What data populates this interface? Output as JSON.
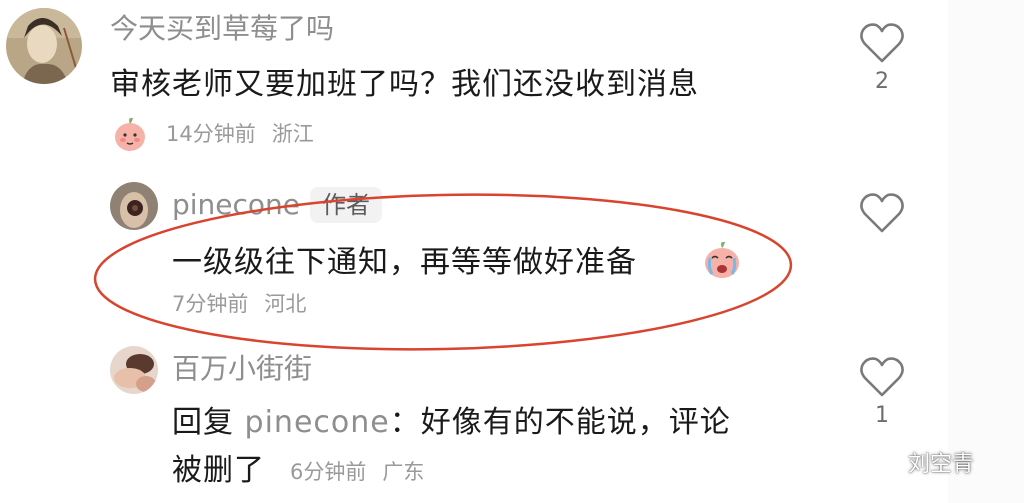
{
  "comments": [
    {
      "username": "今天买到草莓了吗",
      "text": "审核老师又要加班了吗？我们还没收到消息",
      "time": "14分钟前",
      "location": "浙江",
      "likes": "2",
      "emoji": "peach-face-icon"
    }
  ],
  "replies": [
    {
      "username": "pinecone",
      "badge": "作者",
      "text": "一级级往下通知，再等等做好准备",
      "time": "7分钟前",
      "location": "河北",
      "likes": "",
      "highlighted": true,
      "highlight_color": "#d9442e"
    },
    {
      "username": "百万小街街",
      "reply_prefix": "回复",
      "reply_to": "pinecone",
      "reply_colon": "：",
      "text_line1": "好像有的不能说，评论",
      "text_line2": "被删了",
      "time": "6分钟前",
      "location": "广东",
      "likes": "1"
    }
  ],
  "watermark": {
    "text": "刘空青",
    "icon": "wechat-icon"
  }
}
